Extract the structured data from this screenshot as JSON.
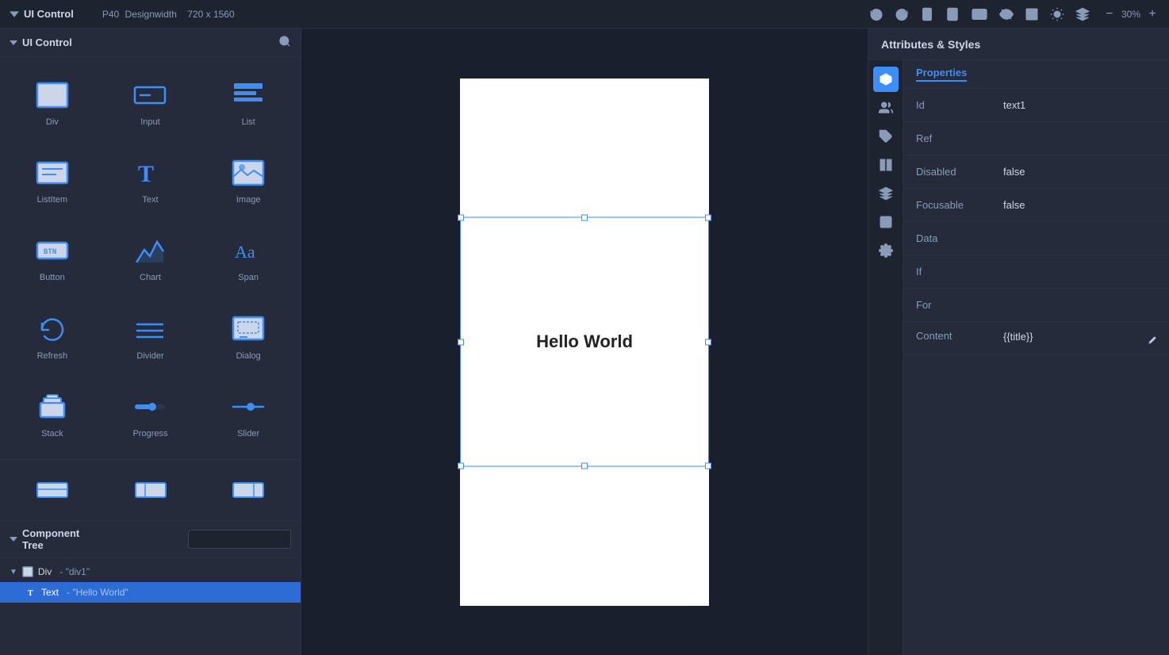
{
  "app": {
    "title": "UI Control"
  },
  "device": {
    "model": "P40",
    "design_width_label": "Designwidth",
    "resolution": "720 x 1560",
    "zoom": "30%"
  },
  "components": [
    {
      "id": "div",
      "label": "Div",
      "icon": "div-icon"
    },
    {
      "id": "input",
      "label": "Input",
      "icon": "input-icon"
    },
    {
      "id": "list",
      "label": "List",
      "icon": "list-icon"
    },
    {
      "id": "listitem",
      "label": "ListItem",
      "icon": "listitem-icon"
    },
    {
      "id": "text",
      "label": "Text",
      "icon": "text-icon"
    },
    {
      "id": "image",
      "label": "Image",
      "icon": "image-icon"
    },
    {
      "id": "button",
      "label": "Button",
      "icon": "button-icon"
    },
    {
      "id": "chart",
      "label": "Chart",
      "icon": "chart-icon"
    },
    {
      "id": "span",
      "label": "Span",
      "icon": "span-icon"
    },
    {
      "id": "refresh",
      "label": "Refresh",
      "icon": "refresh-icon"
    },
    {
      "id": "divider",
      "label": "Divider",
      "icon": "divider-icon"
    },
    {
      "id": "dialog",
      "label": "Dialog",
      "icon": "dialog-icon"
    },
    {
      "id": "stack",
      "label": "Stack",
      "icon": "stack-icon"
    },
    {
      "id": "progress",
      "label": "Progress",
      "icon": "progress-icon"
    },
    {
      "id": "slider",
      "label": "Slider",
      "icon": "slider-icon"
    }
  ],
  "toolbar": {
    "undo_icon": "undo-icon",
    "redo_icon": "redo-icon",
    "phone_icon": "phone-icon",
    "tablet_icon": "tablet-icon",
    "tablet_landscape_icon": "tablet-landscape-icon",
    "mask_icon": "mask-icon",
    "rect_icon": "rect-icon",
    "brightness_icon": "brightness-icon",
    "layers_icon": "layers-icon"
  },
  "canvas": {
    "hello_world": "Hello World"
  },
  "component_tree": {
    "title": "Component\nTree",
    "search_placeholder": "",
    "items": [
      {
        "id": "div1",
        "label": "Div",
        "value": "- \"div1\"",
        "level": 0,
        "collapsed": false,
        "selected": false
      },
      {
        "id": "text1",
        "label": "Text",
        "value": "- \"Hello World\"",
        "level": 1,
        "selected": true
      }
    ]
  },
  "attributes": {
    "panel_title": "Attributes & Styles",
    "tab_properties": "Properties",
    "fields": [
      {
        "label": "Id",
        "value": "text1",
        "key": "id"
      },
      {
        "label": "Ref",
        "value": "",
        "key": "ref"
      },
      {
        "label": "Disabled",
        "value": "false",
        "key": "disabled"
      },
      {
        "label": "Focusable",
        "value": "false",
        "key": "focusable"
      },
      {
        "label": "Data",
        "value": "",
        "key": "data"
      },
      {
        "label": "If",
        "value": "",
        "key": "if_field"
      },
      {
        "label": "For",
        "value": "",
        "key": "for_field"
      },
      {
        "label": "Content",
        "value": "{{title}}",
        "key": "content"
      }
    ]
  },
  "side_icons": [
    {
      "id": "properties",
      "icon": "properties-icon",
      "active": true
    },
    {
      "id": "users",
      "icon": "users-icon",
      "active": false
    },
    {
      "id": "puzzle",
      "icon": "puzzle-icon",
      "active": false
    },
    {
      "id": "columns",
      "icon": "columns-icon",
      "active": false
    },
    {
      "id": "layers2",
      "icon": "layers2-icon",
      "active": false
    },
    {
      "id": "square",
      "icon": "square-icon",
      "active": false
    },
    {
      "id": "gear",
      "icon": "gear-icon",
      "active": false
    }
  ]
}
